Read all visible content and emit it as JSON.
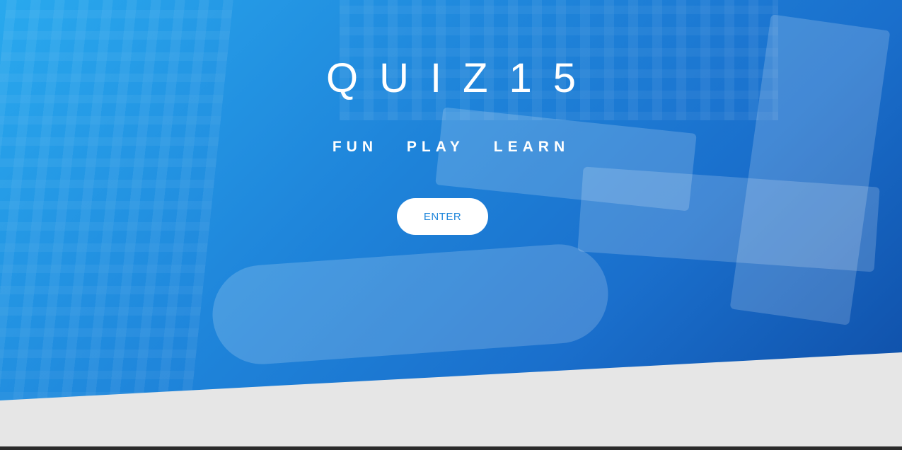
{
  "hero": {
    "title": "QUIZ15",
    "tagline": [
      "FUN",
      "PLAY",
      "LEARN"
    ],
    "enter_label": "ENTER"
  },
  "colors": {
    "hero_gradient_start": "#29a9ee",
    "hero_gradient_end": "#0f4fa8",
    "button_text": "#1f86db",
    "lower_section": "#e6e6e6"
  }
}
